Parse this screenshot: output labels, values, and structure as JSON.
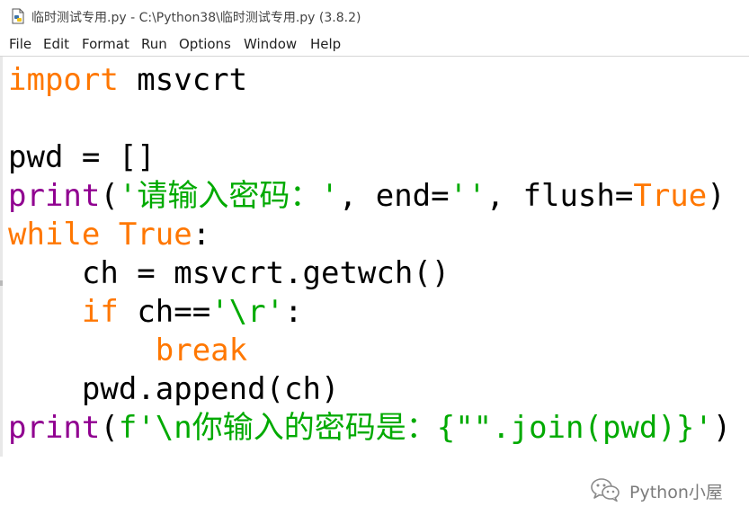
{
  "window": {
    "title": "临时测试专用.py - C:\\Python38\\临时测试专用.py (3.8.2)",
    "icon": "python-file-icon"
  },
  "menu": {
    "items": [
      "File",
      "Edit",
      "Format",
      "Run",
      "Options",
      "Window",
      "Help"
    ]
  },
  "code": {
    "language": "python",
    "lines": [
      "import msvcrt",
      "",
      "pwd = []",
      "print('请输入密码：', end='', flush=True)",
      "while True:",
      "    ch = msvcrt.getwch()",
      "    if ch=='\\r':",
      "        break",
      "    pwd.append(ch)",
      "print(f'\\n你输入的密码是：{\"\".join(pwd)}')"
    ]
  },
  "colors": {
    "keyword": "#ff7700",
    "builtin": "#900090",
    "string": "#00aa00",
    "default": "#000000"
  },
  "watermark": {
    "text": "Python小屋",
    "icon": "wechat-icon"
  }
}
